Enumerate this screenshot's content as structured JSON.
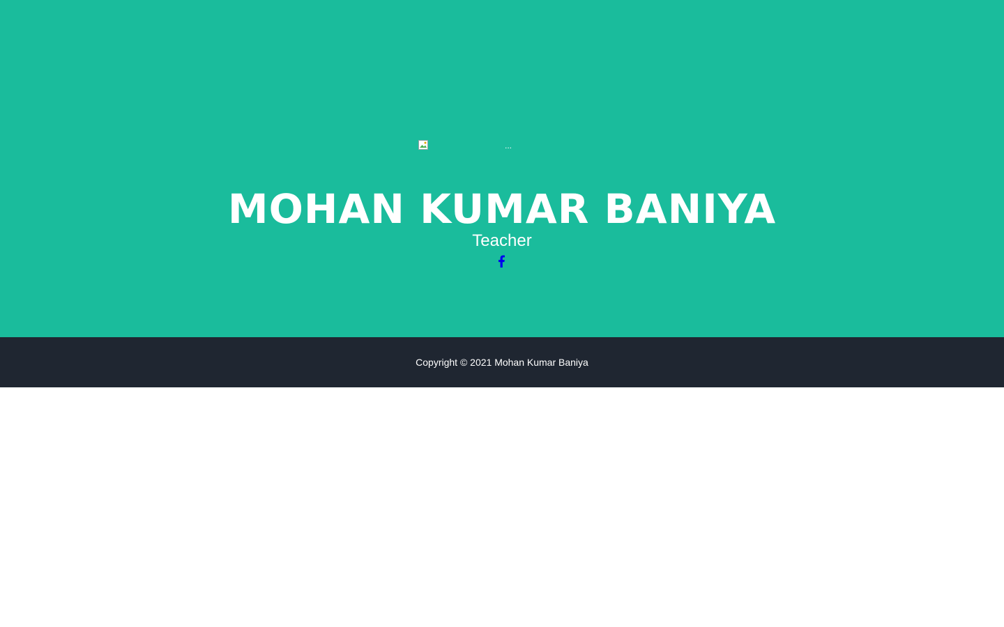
{
  "masthead": {
    "avatar_alt": "...",
    "name": "MOHAN KUMAR BANIYA",
    "role": "Teacher",
    "social": [
      {
        "icon": "facebook-icon"
      }
    ]
  },
  "footer": {
    "copyright": "Copyright © 2021 Mohan Kumar Baniya"
  },
  "colors": {
    "masthead_bg": "#1abc9c",
    "footer_bg": "#1f2631",
    "link": "#0000ee",
    "text": "#ffffff"
  }
}
